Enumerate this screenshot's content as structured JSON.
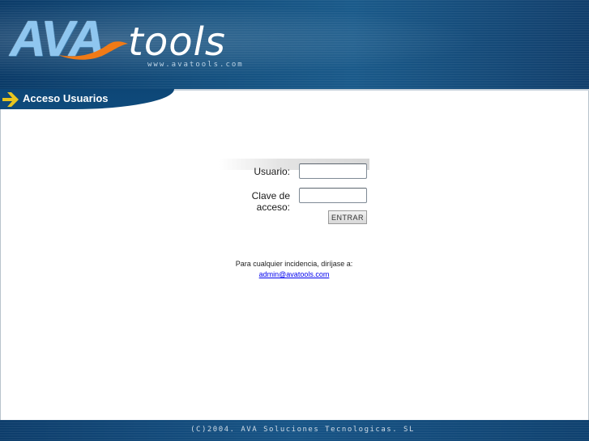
{
  "header": {
    "logo_ava": "AVA",
    "logo_tools": "tools",
    "logo_url": "www.avatools.com"
  },
  "section": {
    "title": "Acceso Usuarios"
  },
  "login": {
    "user_label": "Usuario:",
    "user_value": "",
    "password_label": "Clave de acceso:",
    "password_value": "",
    "submit_label": "ENTRAR"
  },
  "contact": {
    "text": "Para cualquier incidencia, diríjase a:",
    "email": "admin@avatools.com"
  },
  "footer": {
    "copyright": "(C)2004. AVA Soluciones Tecnologicas. SL"
  },
  "colors": {
    "header_blue": "#14507f",
    "arrow_yellow": "#e8c51f",
    "link": "#0000ee"
  },
  "icons": {
    "section_arrow": "arrow-right-icon"
  }
}
